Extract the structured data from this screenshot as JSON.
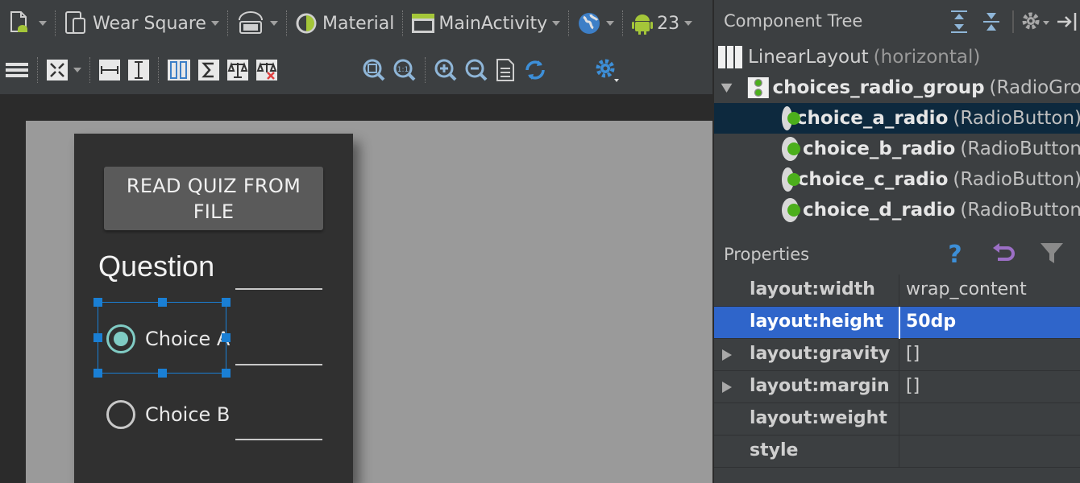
{
  "toolbar1": {
    "device": "Wear Square",
    "theme": "Material",
    "activity": "MainActivity",
    "api_level": "23"
  },
  "preview": {
    "read_button": "READ QUIZ FROM FILE",
    "question": "Question",
    "choice_a": "Choice A",
    "choice_b": "Choice B",
    "choice_a_checked": true,
    "choice_b_checked": false
  },
  "component_tree": {
    "title": "Component Tree",
    "root": {
      "name": "LinearLayout",
      "type": "(horizontal)"
    },
    "group": {
      "name": "choices_radio_group",
      "type": "(RadioGro"
    },
    "children": [
      {
        "name": "choice_a_radio",
        "type": "(RadioButton)",
        "selected": true
      },
      {
        "name": "choice_b_radio",
        "type": "(RadioButton",
        "selected": false
      },
      {
        "name": "choice_c_radio",
        "type": "(RadioButton)",
        "selected": false
      },
      {
        "name": "choice_d_radio",
        "type": "(RadioButton",
        "selected": false
      }
    ]
  },
  "properties": {
    "title": "Properties",
    "rows": [
      {
        "key": "layout:width",
        "value": "wrap_content",
        "expandable": false,
        "selected": false
      },
      {
        "key": "layout:height",
        "value": "50dp",
        "expandable": false,
        "selected": true
      },
      {
        "key": "layout:gravity",
        "value": "[]",
        "expandable": true,
        "selected": false
      },
      {
        "key": "layout:margin",
        "value": "[]",
        "expandable": true,
        "selected": false
      },
      {
        "key": "layout:weight",
        "value": "",
        "expandable": false,
        "selected": false
      },
      {
        "key": "style",
        "value": "",
        "expandable": false,
        "selected": false
      }
    ]
  },
  "colors": {
    "accent_teal": "#80cbc4",
    "selection_blue": "#2f65ca",
    "tree_selected": "#0d293e",
    "android_green": "#a4c639"
  }
}
